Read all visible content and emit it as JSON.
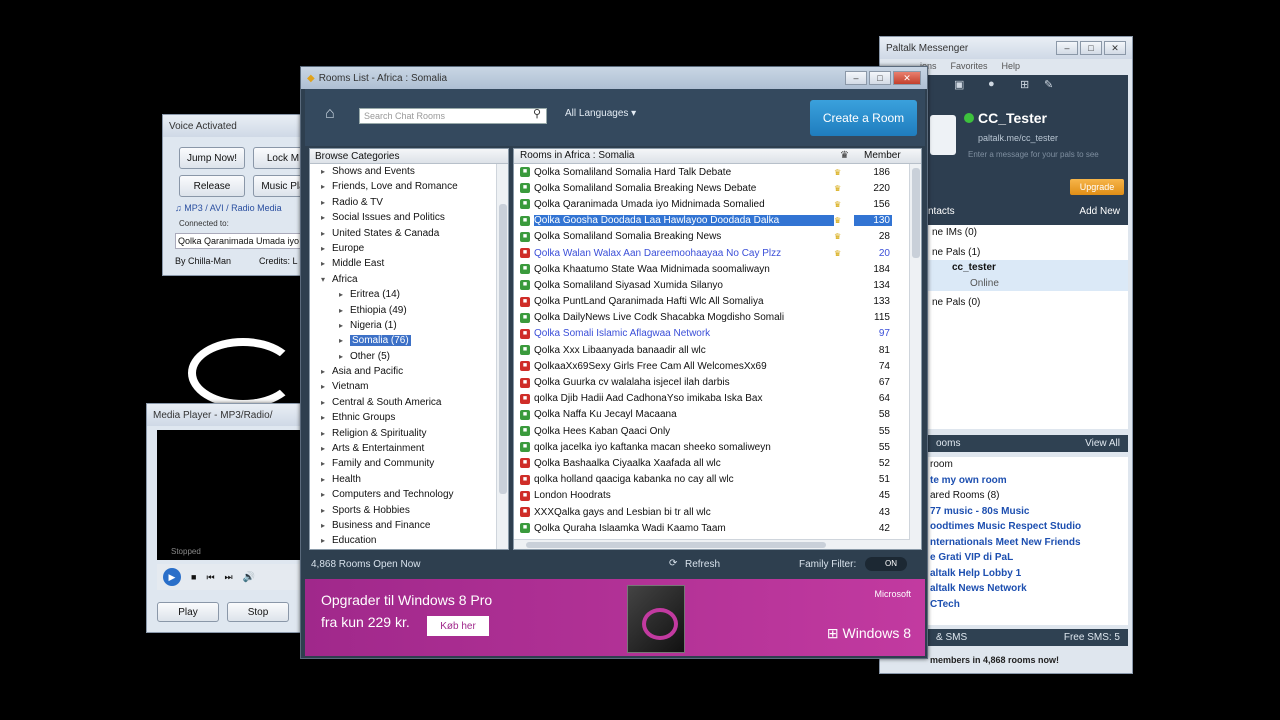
{
  "voice": {
    "title": "Voice Activated",
    "jump": "Jump Now!",
    "lock": "Lock M",
    "release": "Release",
    "music": "Music Pla",
    "sources": "♫ MP3 / AVI / Radio Media",
    "connected": "Connected to:",
    "room": "Qolka Qaranimada Umada iyo",
    "author": "By Chilla-Man",
    "credits": "Credits: L"
  },
  "media": {
    "title": "Media Player - MP3/Radio/",
    "state": "Stopped",
    "play": "Play",
    "stop": "Stop"
  },
  "rooms": {
    "title": "Rooms List - Africa : Somalia",
    "search_placeholder": "Search Chat Rooms",
    "languages": "All Languages",
    "create": "Create a Room",
    "cat_header": "Browse Categories",
    "categories": [
      {
        "label": "Shows and Events"
      },
      {
        "label": "Friends, Love and Romance"
      },
      {
        "label": "Radio & TV"
      },
      {
        "label": "Social Issues and Politics"
      },
      {
        "label": "United States & Canada"
      },
      {
        "label": "Europe"
      },
      {
        "label": "Middle East"
      },
      {
        "label": "Africa"
      },
      {
        "label": "Eritrea (14)"
      },
      {
        "label": "Ethiopia (49)"
      },
      {
        "label": "Nigeria (1)"
      },
      {
        "label": "Somalia (76)"
      },
      {
        "label": "Other (5)"
      },
      {
        "label": "Asia and Pacific"
      },
      {
        "label": "Vietnam"
      },
      {
        "label": "Central & South America"
      },
      {
        "label": "Ethnic Groups"
      },
      {
        "label": "Religion & Spirituality"
      },
      {
        "label": "Arts & Entertainment"
      },
      {
        "label": "Family and Community"
      },
      {
        "label": "Health"
      },
      {
        "label": "Computers and Technology"
      },
      {
        "label": "Sports & Hobbies"
      },
      {
        "label": "Business and Finance"
      },
      {
        "label": "Education"
      }
    ],
    "list_header": "Rooms in Africa : Somalia",
    "members_header": "Member",
    "list": [
      {
        "name": "Qolka Somaliland Somalia Hard Talk Debate",
        "count": "186",
        "crown": true
      },
      {
        "name": "Qolka Somaliland Somalia Breaking News Debate",
        "count": "220",
        "crown": true
      },
      {
        "name": "Qolka Qaranimada Umada iyo Midnimada Somalied",
        "count": "156",
        "crown": true
      },
      {
        "name": "Qolka Goosha Doodada Laa Hawlayoo Doodada Dalka",
        "count": "130",
        "crown": true
      },
      {
        "name": "Qolka Somaliland Somalia Breaking News",
        "count": "28",
        "crown": true
      },
      {
        "name": "Qolka Walan Walax Aan Dareemoohaayaa No Cay Plzz",
        "count": "20",
        "crown": true
      },
      {
        "name": "Qolka Khaatumo State Waa Midnimada soomaliwayn",
        "count": "184",
        "crown": false
      },
      {
        "name": "Qolka Somaliland Siyasad Xumida Silanyo",
        "count": "134",
        "crown": false
      },
      {
        "name": "Qolka PuntLand Qaranimada Hafti Wlc All Somaliya",
        "count": "133",
        "crown": false
      },
      {
        "name": "Qolka DailyNews Live Codk Shacabka Mogdisho Somali",
        "count": "115",
        "crown": false
      },
      {
        "name": "Qolka Somali Islamic Aflagwaa Network",
        "count": "97",
        "crown": false
      },
      {
        "name": "Qolka Xxx Libaanyada banaadir all wlc",
        "count": "81",
        "crown": false
      },
      {
        "name": "QolkaaXx69Sexy Girls Free Cam All WelcomesXx69",
        "count": "74",
        "crown": false
      },
      {
        "name": "Qolka Guurka cv walalaha isjecel ilah darbis",
        "count": "67",
        "crown": false
      },
      {
        "name": "qolka Djib Hadii Aad CadhonaYso imikaba Iska Bax",
        "count": "64",
        "crown": false
      },
      {
        "name": "Qolka Naffa Ku Jecayl Macaana",
        "count": "58",
        "crown": false
      },
      {
        "name": "Qolka Hees Kaban Qaaci Only",
        "count": "55",
        "crown": false
      },
      {
        "name": "qolka jacelka iyo kaftanka macan sheeko somaliweyn",
        "count": "55",
        "crown": false
      },
      {
        "name": "Qolka Bashaalka Ciyaalka Xaafada all wlc",
        "count": "52",
        "crown": false
      },
      {
        "name": "qolka holland qaaciga kabanka no cay all wlc",
        "count": "51",
        "crown": false
      },
      {
        "name": "London Hoodrats",
        "count": "45",
        "crown": false
      },
      {
        "name": "XXXQalka gays and Lesbian bi tr all wlc",
        "count": "43",
        "crown": false
      },
      {
        "name": "Qolka Quraha Islaamka Wadi Kaamo Taam",
        "count": "42",
        "crown": false
      }
    ],
    "status_left": "4,868 Rooms Open Now",
    "refresh": "Refresh",
    "family_filter": "Family Filter:",
    "filter_state": "ON",
    "ad": {
      "line1": "Opgrader til Windows 8 Pro",
      "line2": "fra kun 229 kr.",
      "button": "Køb her",
      "brand": "Microsoft",
      "product": "Windows 8"
    }
  },
  "messenger": {
    "title": "Paltalk Messenger",
    "menu": [
      "ions",
      "Favorites",
      "Help"
    ],
    "username": "CC_Tester",
    "url": "paltalk.me/cc_tester",
    "message_placeholder": "Enter a message for your pals to see",
    "upgrade": "Upgrade",
    "contacts": "ntacts",
    "add_new": "Add New",
    "contact_rows": [
      {
        "label": "ne IMs (0)"
      },
      {
        "label": "ne Pals (1)"
      },
      {
        "label": "cc_tester"
      },
      {
        "label": "Online"
      },
      {
        "label": "ne Pals (0)"
      }
    ],
    "rooms_header": "ooms",
    "view_all": "View All",
    "room_rows": [
      {
        "label": "room"
      },
      {
        "label": "te my own room"
      },
      {
        "label": "ared Rooms (8)"
      },
      {
        "label": "77 music - 80s Music"
      },
      {
        "label": "oodtimes Music Respect Studio"
      },
      {
        "label": "nternationals Meet New Friends"
      },
      {
        "label": "e Grati VIP di PaL"
      },
      {
        "label": "altalk Help Lobby 1"
      },
      {
        "label": "altalk News Network"
      },
      {
        "label": "CTech"
      }
    ],
    "sms": "& SMS",
    "free_sms": "Free SMS: 5",
    "footer": "members in 4,868 rooms now!"
  }
}
